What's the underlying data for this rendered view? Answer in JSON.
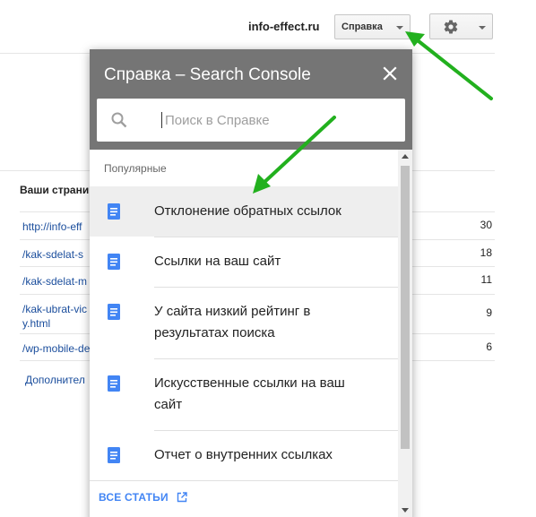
{
  "topbar": {
    "site": "info-effect.ru",
    "help_label": "Справка"
  },
  "background": {
    "heading": "Ваши страни",
    "rows": [
      {
        "url": "http://info-eff",
        "count": "30"
      },
      {
        "url": "/kak-sdelat-s",
        "count": "18"
      },
      {
        "url": "/kak-sdelat-m",
        "count": "11"
      },
      {
        "url": "/kak-ubrat-vic",
        "url2": "y.html",
        "count": "9"
      },
      {
        "url": "/wp-mobile-de",
        "count": "6"
      }
    ],
    "more_link": "Дополнител"
  },
  "help_panel": {
    "title": "Справка – Search Console",
    "search_placeholder": "Поиск в Справке",
    "section_label": "Популярные",
    "items": [
      {
        "line1": "Отклонение обратных ссылок",
        "line2": ""
      },
      {
        "line1": "Ссылки на ваш сайт",
        "line2": ""
      },
      {
        "line1": "У сайта низкий рейтинг в",
        "line2": "результатах поиска"
      },
      {
        "line1": "Искусственные ссылки на ваш",
        "line2": "сайт"
      },
      {
        "line1": "Отчет о внутренних ссылках",
        "line2": ""
      }
    ],
    "all_articles": "ВСЕ СТАТЬИ"
  },
  "icons": {
    "gear": "gear-icon",
    "close": "close-icon",
    "search": "search-icon",
    "document": "document-icon",
    "external_link": "external-link-icon",
    "annotation_arrow": "green-arrow"
  },
  "colors": {
    "panel_header": "#757575",
    "link": "#1a4d9c",
    "accent": "#4285f4",
    "annotation": "#22b01e"
  }
}
